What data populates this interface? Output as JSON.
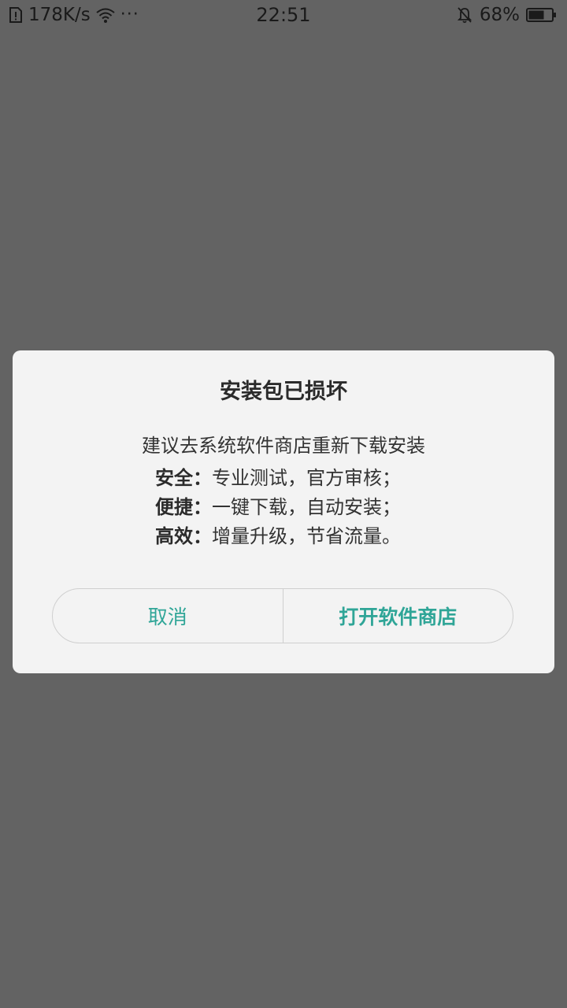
{
  "status_bar": {
    "net_speed": "178K/s",
    "more_glyph": "···",
    "time": "22:51",
    "battery_percent": "68%",
    "battery_level": 0.68,
    "icons": [
      "sim-alert-icon",
      "wifi-icon",
      "more-icon",
      "mute-bell-icon",
      "battery-icon"
    ]
  },
  "dialog": {
    "title": "安装包已损坏",
    "message": "建议去系统软件商店重新下载安装",
    "features": [
      {
        "label": "安全：",
        "text": "专业测试，官方审核；"
      },
      {
        "label": "便捷：",
        "text": "一键下载，自动安装；"
      },
      {
        "label": "高效：",
        "text": "增量升级，节省流量。"
      }
    ],
    "cancel_label": "取消",
    "confirm_label": "打开软件商店"
  },
  "colors": {
    "overlay": "#636363",
    "dialog_bg": "#f3f3f3",
    "accent": "#2fa597"
  }
}
